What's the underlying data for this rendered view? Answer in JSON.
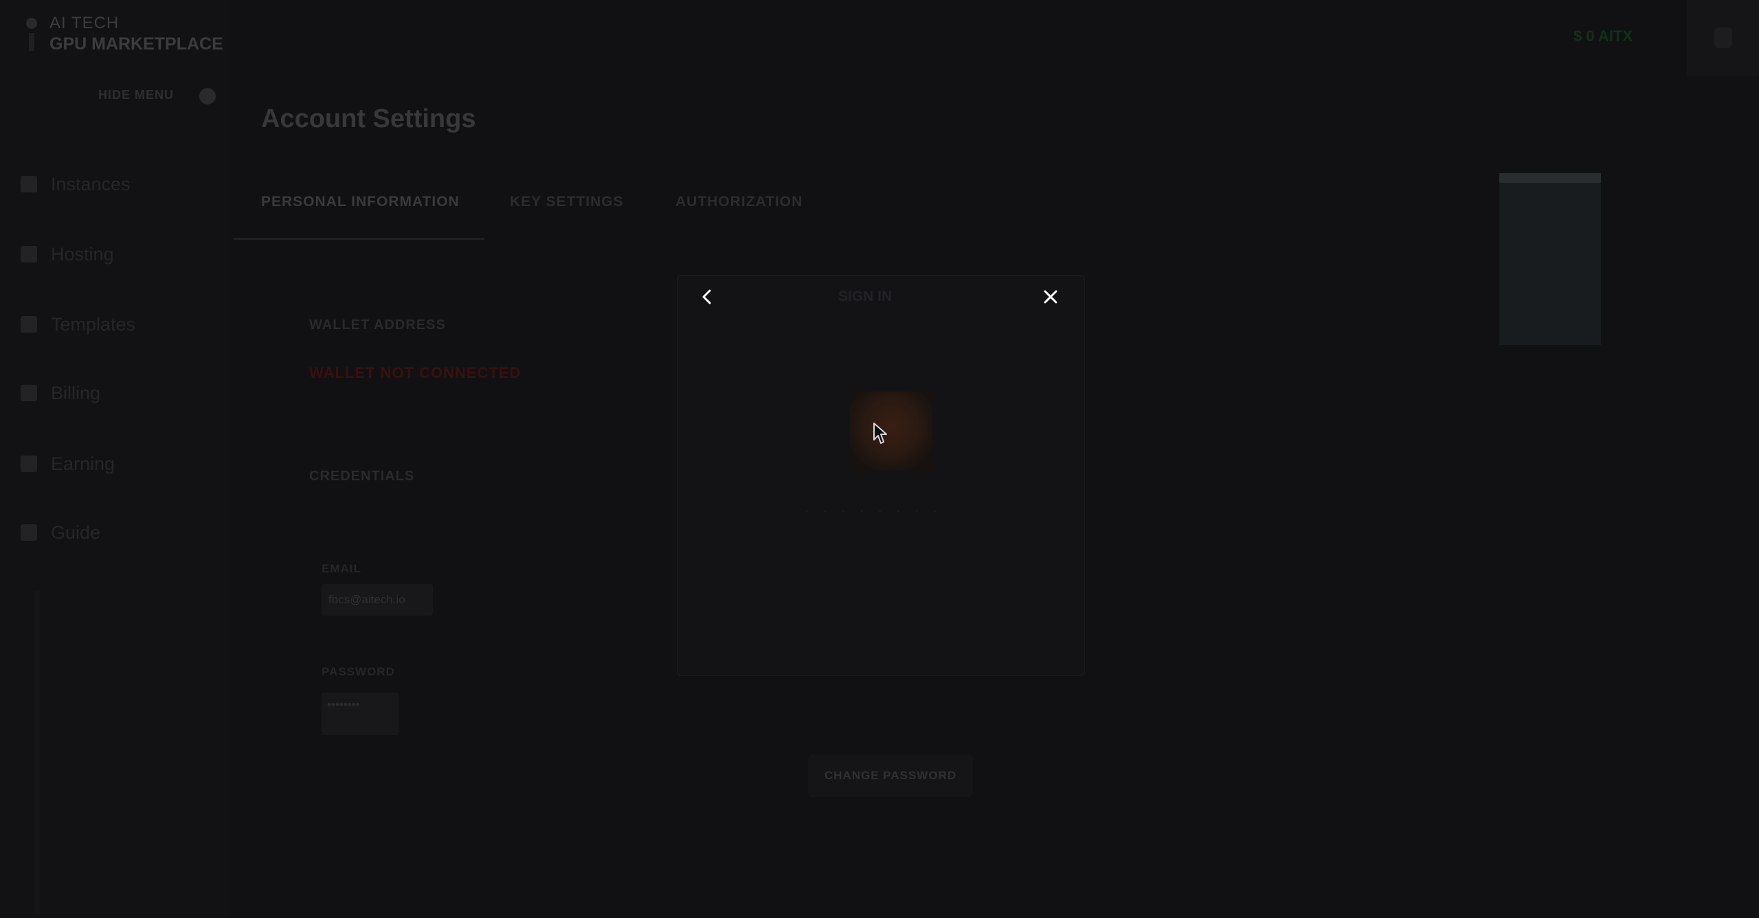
{
  "brand": {
    "top": "AI TECH",
    "bottom": "GPU MARKETPLACE"
  },
  "sidebar": {
    "hide_menu": "HIDE MENU",
    "items": [
      {
        "label": "Instances",
        "icon": "instances-icon"
      },
      {
        "label": "Hosting",
        "icon": "hosting-icon"
      },
      {
        "label": "Templates",
        "icon": "templates-icon"
      },
      {
        "label": "Billing",
        "icon": "billing-icon"
      },
      {
        "label": "Earning",
        "icon": "earning-icon"
      },
      {
        "label": "Guide",
        "icon": "guide-icon"
      }
    ]
  },
  "header": {
    "balance": "$ 0 AITX"
  },
  "main": {
    "title": "Account Settings",
    "tabs": [
      {
        "label": "PERSONAL INFORMATION",
        "active": true
      },
      {
        "label": "KEY SETTINGS",
        "active": false
      },
      {
        "label": "AUTHORIZATION",
        "active": false
      }
    ],
    "wallet": {
      "label": "WALLET ADDRESS",
      "status": "WALLET NOT CONNECTED"
    },
    "credentials": {
      "label": "CREDENTIALS",
      "email_label": "EMAIL",
      "email_value": "fbcs@aitech.io",
      "password_label": "PASSWORD",
      "password_value": "••••••••",
      "change_password": "CHANGE PASSWORD"
    }
  },
  "modal": {
    "title": "SIGN IN",
    "info": "· · · · · · · ·",
    "back_icon": "chevron-left-icon",
    "close_icon": "close-icon"
  },
  "colors": {
    "background": "#111113",
    "danger": "#3a1010",
    "accent": "#12301a"
  }
}
